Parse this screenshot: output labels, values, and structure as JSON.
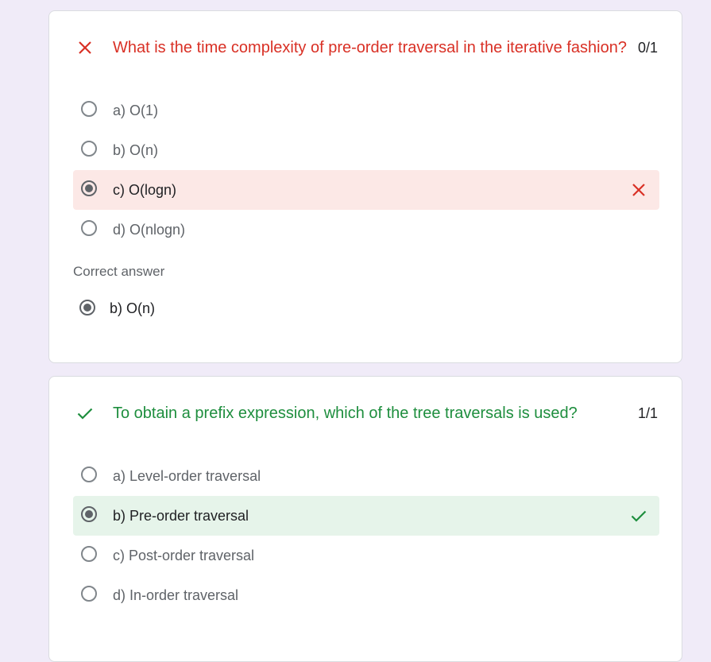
{
  "questions": [
    {
      "text": "What is the time complexity of pre-order traversal in the iterative fashion?",
      "score": "0/1",
      "status": "incorrect",
      "status_icon": "x-icon",
      "options": [
        {
          "label": "a) O(1)"
        },
        {
          "label": "b) O(n)"
        },
        {
          "label": "c) O(logn)"
        },
        {
          "label": "d) O(nlogn)"
        }
      ],
      "selected_index": 2,
      "correct_answer_heading": "Correct answer",
      "correct_answer": "b) O(n)"
    },
    {
      "text": "To obtain a prefix expression, which of the tree traversals is used?",
      "score": "1/1",
      "status": "correct",
      "status_icon": "check-icon",
      "options": [
        {
          "label": "a) Level-order traversal"
        },
        {
          "label": "b) Pre-order traversal"
        },
        {
          "label": "c) Post-order traversal"
        },
        {
          "label": "d) In-order traversal"
        }
      ],
      "selected_index": 1
    }
  ],
  "colors": {
    "page_bg": "#f0ebf8",
    "incorrect": "#d93025",
    "correct": "#1e8e3e",
    "incorrect_bg": "#fce8e6",
    "correct_bg": "#e6f4ea"
  }
}
